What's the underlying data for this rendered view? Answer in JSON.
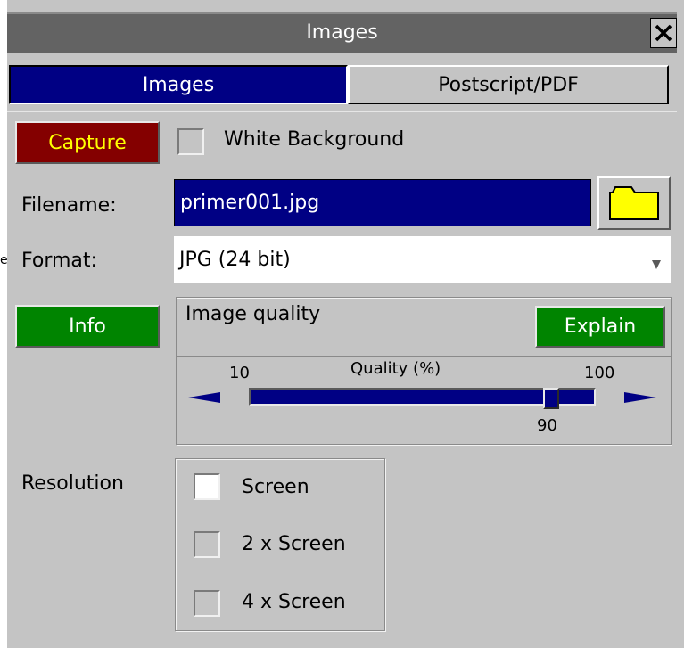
{
  "edge_glyph": "e",
  "window": {
    "title": "Images"
  },
  "tabs": [
    {
      "label": "Images",
      "active": true
    },
    {
      "label": "Postscript/PDF",
      "active": false
    }
  ],
  "capture": {
    "button_label": "Capture",
    "white_background_label": "White Background",
    "white_background_checked": false
  },
  "filename": {
    "label": "Filename:",
    "value": "primer001.jpg"
  },
  "format": {
    "label": "Format:",
    "value": "JPG (24 bit)"
  },
  "info": {
    "button_label": "Info"
  },
  "quality": {
    "group_label": "Image quality",
    "explain_label": "Explain",
    "slider_label": "Quality (%)",
    "min": "10",
    "max": "100",
    "value": "90"
  },
  "resolution": {
    "label": "Resolution",
    "options": [
      {
        "label": "Screen",
        "checked": true
      },
      {
        "label": "2 x Screen",
        "checked": false
      },
      {
        "label": "4 x Screen",
        "checked": false
      }
    ]
  },
  "colors": {
    "titlebar": "#636363",
    "active_tab": "#000084",
    "capture_button": "#840000",
    "capture_text": "#ffff00",
    "info_button": "#008400",
    "panel": "#c4c4c4",
    "folder_icon": "#ffff00"
  },
  "icons": {
    "close": "close-icon",
    "folder": "folder-icon",
    "dropdown": "dropdown-arrow-icon",
    "slider_left": "slider-left-arrow-icon",
    "slider_right": "slider-right-arrow-icon"
  }
}
